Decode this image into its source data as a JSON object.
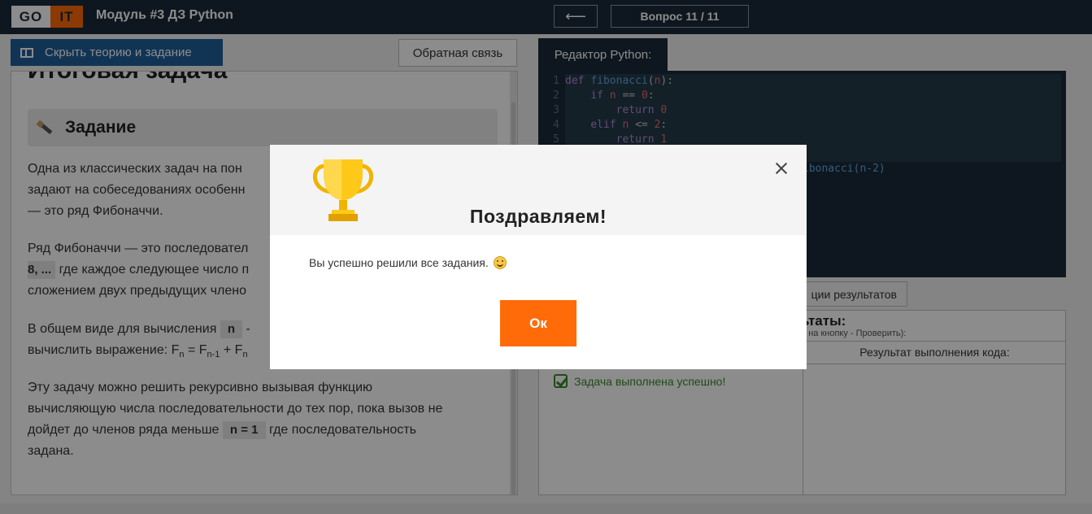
{
  "header": {
    "logo_left": "GO",
    "logo_right": "IT",
    "module_title": "Модуль #3 ДЗ Python",
    "back_arrow": "⟵",
    "question_label": "Вопрос 11 / 11"
  },
  "left_panel": {
    "hide_button": "Скрыть теорию и задание",
    "feedback_button": "Обратная связь",
    "heading": "Итоговая задача",
    "task_title": "Задание",
    "p1_line1": "Одна из классических задач на пон",
    "p1_line2": "задают на собеседованиях особенн",
    "p1_line3": "— это ряд Фибоначчи.",
    "p2_line1": "Ряд Фибоначчи — это последовател",
    "p2_chip": "8, ...",
    "p2_line2": "где каждое следующее число п",
    "p2_line3": "сложением двух предыдущих члено",
    "p3_line1": "В общем виде для вычисления",
    "p3_chip": "n",
    "p3_line2": "вычислить выражение: F",
    "p4_line1": "Эту задачу можно решить рекурсивно вызывая функцию",
    "p4_line2": "вычисляющую числа последовательности до тех пор, пока вызов не",
    "p4_line3a": "дойдет до членов ряда меньше",
    "p4_chip": "n = 1",
    "p4_line3b": "где последовательность",
    "p4_line4": "задана."
  },
  "editor": {
    "tab_label": "Редактор Python:",
    "line_numbers": [
      "1",
      "2",
      "3",
      "4",
      "5"
    ],
    "tail_text": "ibonacci(n-2)"
  },
  "results": {
    "run_button": "ции результатов",
    "title": "ьтаты:",
    "subtitle": "и на кнопку - Проверить):",
    "col2_header": "Результат выполнения кода:",
    "success_text": "Задача выполнена успешно!"
  },
  "modal": {
    "title": "Поздравляем!",
    "message": "Вы успешно решили все задания.",
    "ok_button": "Ок",
    "icons": [
      "trophy-icon",
      "close-icon",
      "smile-icon"
    ]
  },
  "colors": {
    "navy": "#1b2a3a",
    "accent": "#ff6b08",
    "blue_button": "#1f5f9a",
    "success": "#3a8a2a"
  }
}
